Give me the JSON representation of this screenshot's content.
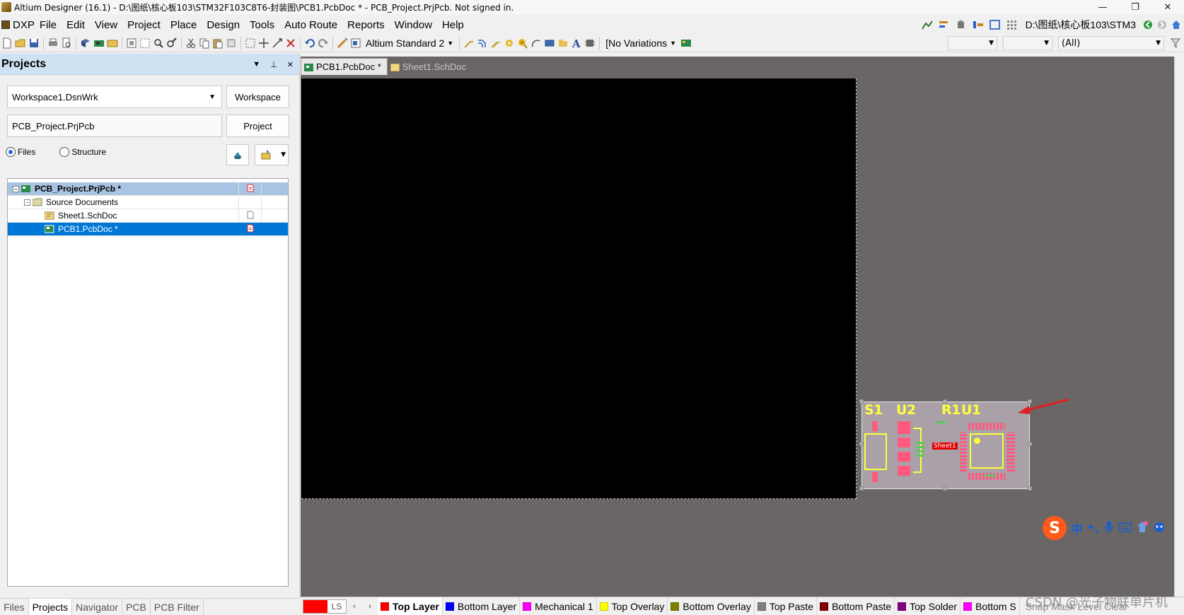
{
  "window": {
    "title": "Altium Designer (16.1) - D:\\图纸\\核心板103\\STM32F103C8T6-封装图\\PCB1.PcbDoc * - PCB_Project.PrjPcb. Not signed in.",
    "minimize": "—",
    "restore": "❐",
    "close": "✕"
  },
  "menubar": {
    "items": [
      "DXP",
      "File",
      "Edit",
      "View",
      "Project",
      "Place",
      "Design",
      "Tools",
      "Auto Route",
      "Reports",
      "Window",
      "Help"
    ],
    "path": "D:\\图纸\\核心板103\\STM3"
  },
  "toolbar": {
    "standard_combo": "Altium Standard 2",
    "variations_combo": "[No Variations",
    "filter_all": "(All)"
  },
  "projects_panel": {
    "title": "Projects",
    "workspace_combo": "Workspace1.DsnWrk",
    "workspace_button": "Workspace",
    "project_field": "PCB_Project.PrjPcb",
    "project_button": "Project",
    "radio_files": "Files",
    "radio_structure": "Structure",
    "tree": {
      "project": "PCB_Project.PrjPcb *",
      "folder": "Source Documents",
      "docs": [
        "Sheet1.SchDoc",
        "PCB1.PcbDoc *"
      ]
    },
    "bottom_tabs": [
      "Files",
      "Projects",
      "Navigator",
      "PCB",
      "PCB Filter"
    ],
    "active_bottom_tab": "Projects"
  },
  "document_tabs": [
    {
      "label": "PCB1.PcbDoc *",
      "active": true
    },
    {
      "label": "Sheet1.SchDoc",
      "active": false
    }
  ],
  "pcb": {
    "designators": [
      "S1",
      "U2",
      "R1",
      "U1"
    ],
    "sheet_label": "Sheet1"
  },
  "ime": {
    "logo": "S",
    "mode": "中",
    "punct": "•,"
  },
  "layer_bar": {
    "ls_label": "LS",
    "prev": "‹",
    "next": "›",
    "layers": [
      {
        "name": "Top Layer",
        "color": "#ff0000"
      },
      {
        "name": "Bottom Layer",
        "color": "#0000ff"
      },
      {
        "name": "Mechanical 1",
        "color": "#ff00ff"
      },
      {
        "name": "Top Overlay",
        "color": "#ffff00"
      },
      {
        "name": "Bottom Overlay",
        "color": "#808000"
      },
      {
        "name": "Top Paste",
        "color": "#808080"
      },
      {
        "name": "Bottom Paste",
        "color": "#800000"
      },
      {
        "name": "Top Solder",
        "color": "#800080"
      },
      {
        "name": "Bottom S",
        "color": "#ff00ff"
      }
    ],
    "trailing": "Snap  Mask Level  Clear",
    "watermark": "CSDN @光子物联单片机"
  }
}
